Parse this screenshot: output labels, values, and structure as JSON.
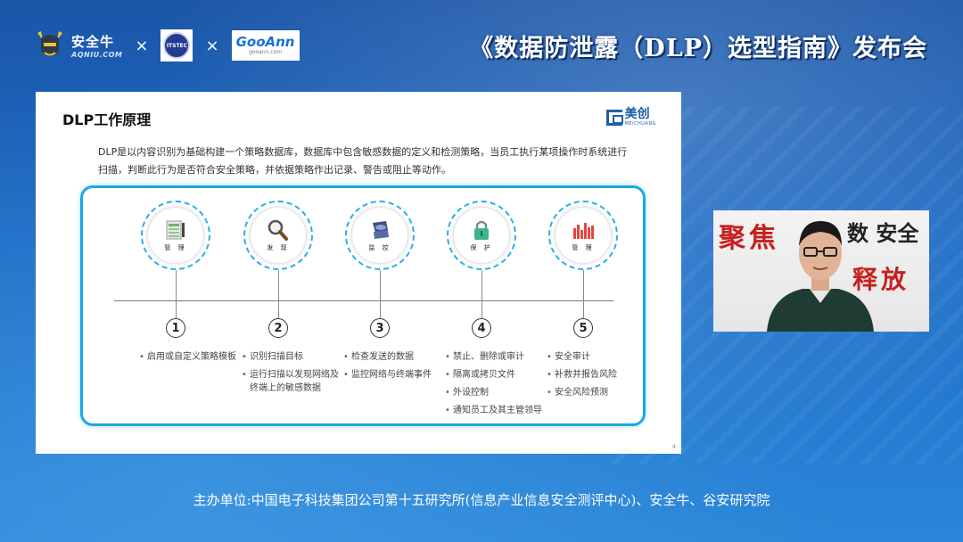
{
  "header": {
    "logo_aqn_cn": "安全牛",
    "logo_aqn_en": "AQNIU.COM",
    "times_1": "×",
    "times_2": "×",
    "logo_itsec": "ITSTEC",
    "logo_gooann": "GooAnn",
    "logo_gooann_sub": "gooann.com",
    "event_title": "《数据防泄露（DLP）选型指南》发布会"
  },
  "slide": {
    "title": "DLP工作原理",
    "brand_cn": "美创",
    "brand_en": "MEICHUANG",
    "description": "DLP是以内容识别为基础构建一个策略数据库，数据库中包含敏感数据的定义和检测策略，当员工执行某项操作时系统进行扫描，判断此行为是否符合安全策略，并依据策略作出记录、警告或阻止等动作。",
    "page_number": "4",
    "steps": [
      {
        "icon": "list-document-icon",
        "label": "管 理",
        "number": "1",
        "bullets": [
          "启用或自定义策略模板"
        ]
      },
      {
        "icon": "magnifier-icon",
        "label": "发 现",
        "number": "2",
        "bullets": [
          "识别扫描目标",
          "运行扫描以发现网络及终端上的敏感数据"
        ]
      },
      {
        "icon": "monitor-shield-icon",
        "label": "监 控",
        "number": "3",
        "bullets": [
          "检查发送的数据",
          "监控网络与终端事件"
        ]
      },
      {
        "icon": "padlock-icon",
        "label": "保 护",
        "number": "4",
        "bullets": [
          "禁止、删除或审计",
          "隔离或拷贝文件",
          "外设控制",
          "通知员工及其主管领导"
        ]
      },
      {
        "icon": "bar-chart-icon",
        "label": "管 理",
        "number": "5",
        "bullets": [
          "安全审计",
          "补救并报告风险",
          "安全风险预测"
        ]
      }
    ]
  },
  "video": {
    "banner_left": "聚焦",
    "banner_right": "数 安全",
    "banner_bottom": "释放"
  },
  "footer": {
    "organizers": "主办单位:中国电子科技集团公司第十五研究所(信息产业信息安全测评中心)、安全牛、谷安研究院"
  },
  "colors": {
    "accent": "#1ea7e0",
    "title_red": "#c6201f",
    "brand_blue": "#1d5fa8"
  }
}
